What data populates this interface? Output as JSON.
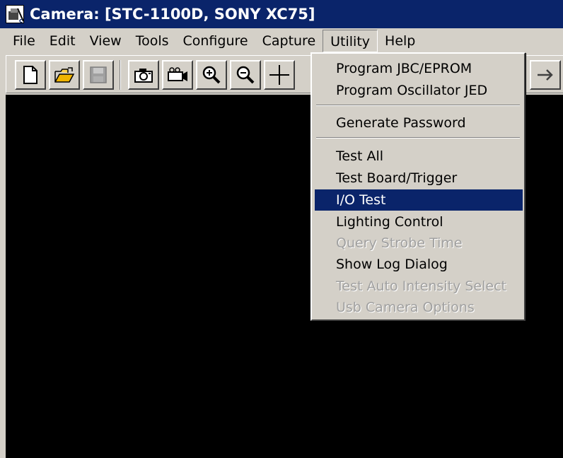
{
  "window": {
    "title": "Camera: [STC-1100D, SONY XC75]",
    "title_bar_color": "#0a246a",
    "app_icon": "camera-app-icon"
  },
  "menubar": {
    "items": [
      {
        "label": "File"
      },
      {
        "label": "Edit"
      },
      {
        "label": "View"
      },
      {
        "label": "Tools"
      },
      {
        "label": "Configure"
      },
      {
        "label": "Capture"
      },
      {
        "label": "Utility",
        "state": "open"
      },
      {
        "label": "Help"
      }
    ]
  },
  "toolbar": {
    "buttons": [
      {
        "icon": "new-file-icon"
      },
      {
        "icon": "open-folder-icon"
      },
      {
        "icon": "save-icon",
        "state": "disabled"
      },
      {
        "icon": "camera-snapshot-icon"
      },
      {
        "icon": "video-camera-icon"
      },
      {
        "icon": "zoom-in-icon"
      },
      {
        "icon": "zoom-out-icon"
      },
      {
        "icon": "crosshair-icon"
      },
      {
        "icon": "arrow-right-icon"
      }
    ]
  },
  "utility_menu": {
    "items": [
      {
        "label": "Program JBC/EPROM",
        "enabled": true
      },
      {
        "label": "Program Oscillator JED",
        "enabled": true
      },
      {
        "label": "Generate Password",
        "enabled": true
      },
      {
        "label": "Test All",
        "enabled": true
      },
      {
        "label": "Test Board/Trigger",
        "enabled": true
      },
      {
        "label": "I/O Test",
        "enabled": true,
        "highlighted": true
      },
      {
        "label": "Lighting Control",
        "enabled": true
      },
      {
        "label": "Query Strobe Time",
        "enabled": false
      },
      {
        "label": "Show Log Dialog",
        "enabled": true
      },
      {
        "label": "Test Auto Intensity Select",
        "enabled": false
      },
      {
        "label": "Usb Camera Options",
        "enabled": false
      }
    ],
    "highlight_color": "#0a246a"
  },
  "viewport": {
    "background": "#000000"
  }
}
